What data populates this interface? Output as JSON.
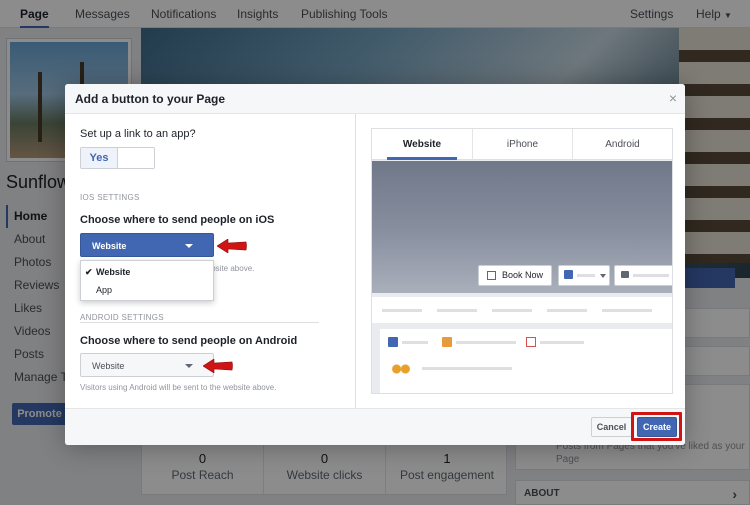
{
  "topnav": {
    "tabs": [
      "Page",
      "Messages",
      "Notifications",
      "Insights",
      "Publishing Tools"
    ],
    "settings": "Settings",
    "help": "Help"
  },
  "page": {
    "name_partial": "Sunflow",
    "nav": [
      "Home",
      "About",
      "Photos",
      "Reviews",
      "Likes",
      "Videos",
      "Posts",
      "Manage Ta"
    ],
    "promote": "Promote",
    "stats": [
      {
        "value": "0",
        "label": "Post Reach"
      },
      {
        "value": "0",
        "label": "Website clicks"
      },
      {
        "value": "1",
        "label": "Post engagement"
      }
    ],
    "liked_text": "Posts from Pages that you've liked as your Page",
    "about": "ABOUT"
  },
  "modal": {
    "title": "Add a button to your Page",
    "close": "×",
    "question": "Set up a link to an app?",
    "toggle_yes": "Yes",
    "ios": {
      "section": "IOS SETTINGS",
      "question": "Choose where to send people on iOS",
      "selected": "Website",
      "helper_partial": "website above.",
      "options": [
        "Website",
        "App"
      ]
    },
    "android": {
      "section": "ANDROID SETTINGS",
      "question": "Choose where to send people on Android",
      "selected": "Website",
      "helper": "Visitors using Android will be sent to the website above."
    },
    "preview": {
      "tabs": [
        "Website",
        "iPhone",
        "Android"
      ],
      "book_now": "Book Now"
    },
    "footer": {
      "cancel": "Cancel",
      "create": "Create"
    }
  },
  "colors": {
    "accent": "#4267b2",
    "highlight": "#d01414",
    "arrow": "#d01414"
  }
}
